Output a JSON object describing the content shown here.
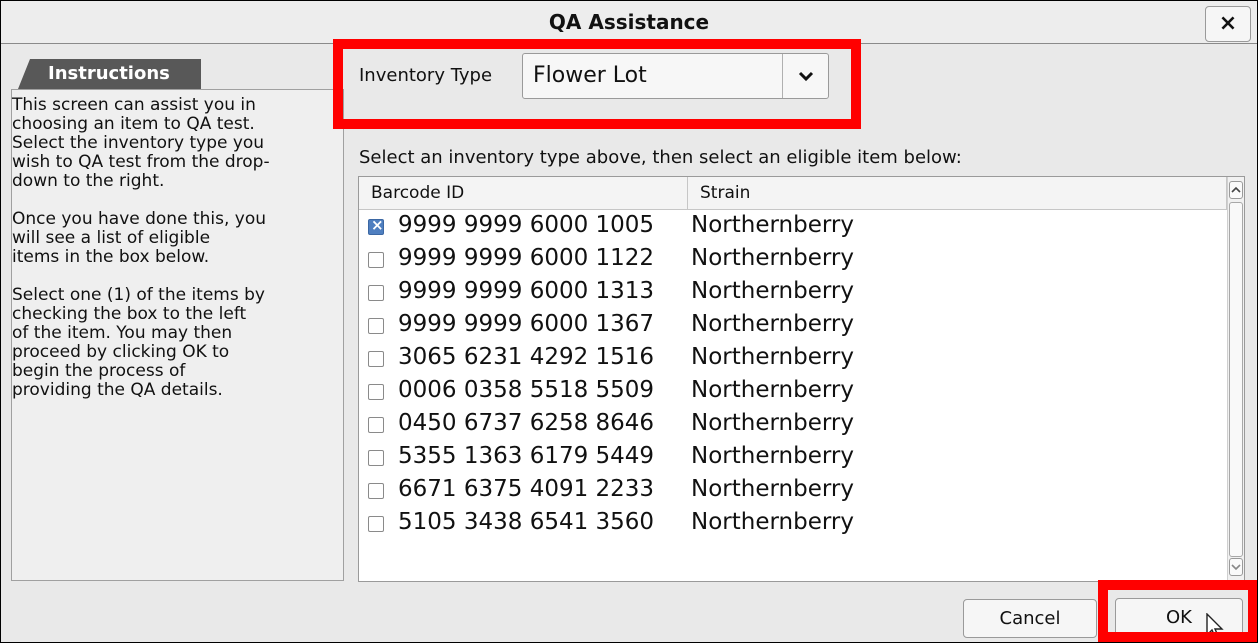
{
  "window": {
    "title": "QA Assistance",
    "close_icon": "close-icon",
    "close_glyph": "×"
  },
  "instructions": {
    "tab_label": "Instructions",
    "text": "This screen can assist you in\nchoosing an item to QA test.\nSelect the inventory type you\nwish to QA test from the drop-\ndown to the right.\n\nOnce you have done this, you\nwill see a list of eligible\nitems in the box below.\n\nSelect one (1) of the items by\nchecking the box to the left\nof the item. You may then\nproceed by clicking OK to\nbegin the process of\nproviding the QA details."
  },
  "inventory": {
    "label": "Inventory Type",
    "selected": "Flower Lot",
    "arrow_icon": "chevron-down-icon"
  },
  "list": {
    "prompt": "Select an inventory type above, then select an eligible item below:",
    "columns": [
      "Barcode ID",
      "Strain"
    ],
    "rows": [
      {
        "checked": true,
        "barcode": "9999 9999 6000 1005",
        "strain": "Northernberry"
      },
      {
        "checked": false,
        "barcode": "9999 9999 6000 1122",
        "strain": "Northernberry"
      },
      {
        "checked": false,
        "barcode": "9999 9999 6000 1313",
        "strain": "Northernberry"
      },
      {
        "checked": false,
        "barcode": "9999 9999 6000 1367",
        "strain": "Northernberry"
      },
      {
        "checked": false,
        "barcode": "3065 6231 4292 1516",
        "strain": "Northernberry"
      },
      {
        "checked": false,
        "barcode": "0006 0358 5518 5509",
        "strain": "Northernberry"
      },
      {
        "checked": false,
        "barcode": "0450 6737 6258 8646",
        "strain": "Northernberry"
      },
      {
        "checked": false,
        "barcode": "5355 1363 6179 5449",
        "strain": "Northernberry"
      },
      {
        "checked": false,
        "barcode": "6671 6375 4091 2233",
        "strain": "Northernberry"
      },
      {
        "checked": false,
        "barcode": "5105 3438 6541 3560",
        "strain": "Northernberry"
      }
    ],
    "scroll_up_icon": "scroll-up-icon",
    "scroll_down_icon": "scroll-down-icon"
  },
  "buttons": {
    "cancel": "Cancel",
    "ok": "OK"
  },
  "annotation_color": "#ff0000",
  "checked_color": "#4f7fc0"
}
